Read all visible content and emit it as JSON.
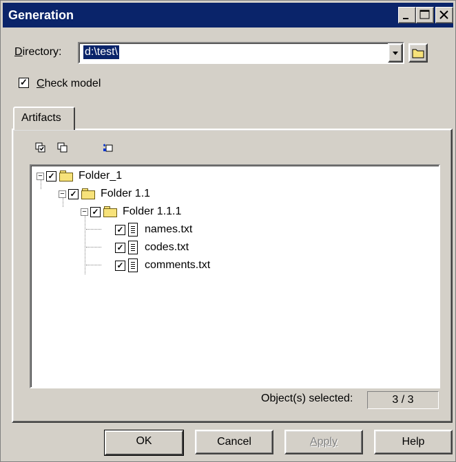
{
  "window": {
    "title": "Generation"
  },
  "directory": {
    "label": "Directory:",
    "value": "d:\\test\\"
  },
  "check_model": {
    "label": "Check model",
    "checked": true
  },
  "tabs": [
    {
      "label": "Artifacts",
      "active": true
    }
  ],
  "toolbar": {
    "icons": [
      "select-all-icon",
      "deselect-all-icon",
      "refresh-icon"
    ]
  },
  "tree": {
    "items": [
      {
        "label": "Folder_1",
        "type": "folder",
        "checked": true,
        "expanded": true
      },
      {
        "label": "Folder 1.1",
        "type": "folder",
        "checked": true,
        "expanded": true
      },
      {
        "label": "Folder 1.1.1",
        "type": "folder",
        "checked": true,
        "expanded": true
      },
      {
        "label": "names.txt",
        "type": "file",
        "checked": true
      },
      {
        "label": "codes.txt",
        "type": "file",
        "checked": true
      },
      {
        "label": "comments.txt",
        "type": "file",
        "checked": true
      }
    ]
  },
  "selection": {
    "label": "Object(s) selected:",
    "value": "3 / 3"
  },
  "buttons": {
    "ok": "OK",
    "cancel": "Cancel",
    "apply": "Apply",
    "help": "Help"
  }
}
